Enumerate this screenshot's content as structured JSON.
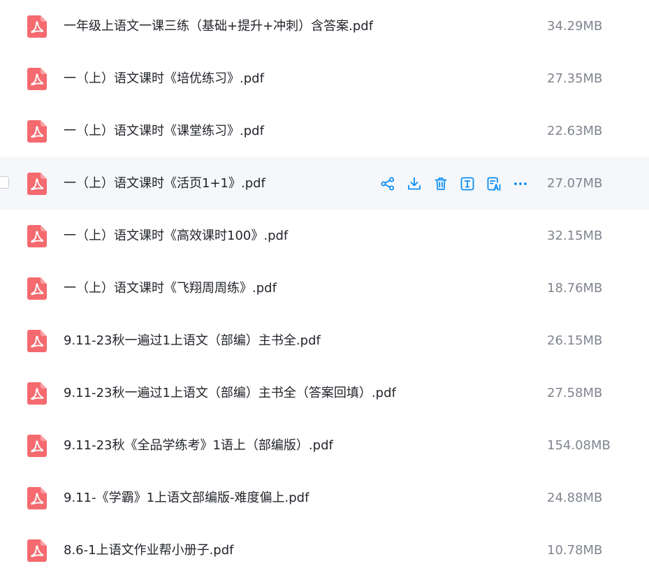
{
  "accent_color": "#0b8ef5",
  "pdf_icon_color": "#f46a6f",
  "files": [
    {
      "name": "一年级上语文一课三练（基础+提升+冲刺）含答案.pdf",
      "size": "34.29MB",
      "icon": "pdf-icon"
    },
    {
      "name": "一（上）语文课时《培优练习》.pdf",
      "size": "27.35MB",
      "icon": "pdf-icon"
    },
    {
      "name": "一（上）语文课时《课堂练习》.pdf",
      "size": "22.63MB",
      "icon": "pdf-icon"
    },
    {
      "name": "一（上）语文课时《活页1+1》.pdf",
      "size": "27.07MB",
      "icon": "pdf-icon",
      "hovered": true
    },
    {
      "name": "一（上）语文课时《高效课时100》.pdf",
      "size": "32.15MB",
      "icon": "pdf-icon"
    },
    {
      "name": "一（上）语文课时《飞翔周周练》.pdf",
      "size": "18.76MB",
      "icon": "pdf-icon"
    },
    {
      "name": "9.11-23秋一遍过1上语文（部编）主书全.pdf",
      "size": "26.15MB",
      "icon": "pdf-icon"
    },
    {
      "name": "9.11-23秋一遍过1上语文（部编）主书全（答案回填）.pdf",
      "size": "27.58MB",
      "icon": "pdf-icon"
    },
    {
      "name": "9.11-23秋《全品学练考》1语上（部编版）.pdf",
      "size": "154.08MB",
      "icon": "pdf-icon"
    },
    {
      "name": "9.11-《学霸》1上语文部编版-难度偏上.pdf",
      "size": "24.88MB",
      "icon": "pdf-icon"
    },
    {
      "name": "8.6-1上语文作业帮小册子.pdf",
      "size": "10.78MB",
      "icon": "pdf-icon"
    }
  ],
  "hover_actions": [
    {
      "name": "share-icon"
    },
    {
      "name": "download-icon"
    },
    {
      "name": "delete-icon"
    },
    {
      "name": "rename-icon"
    },
    {
      "name": "ai-read-icon"
    },
    {
      "name": "more-icon"
    }
  ]
}
